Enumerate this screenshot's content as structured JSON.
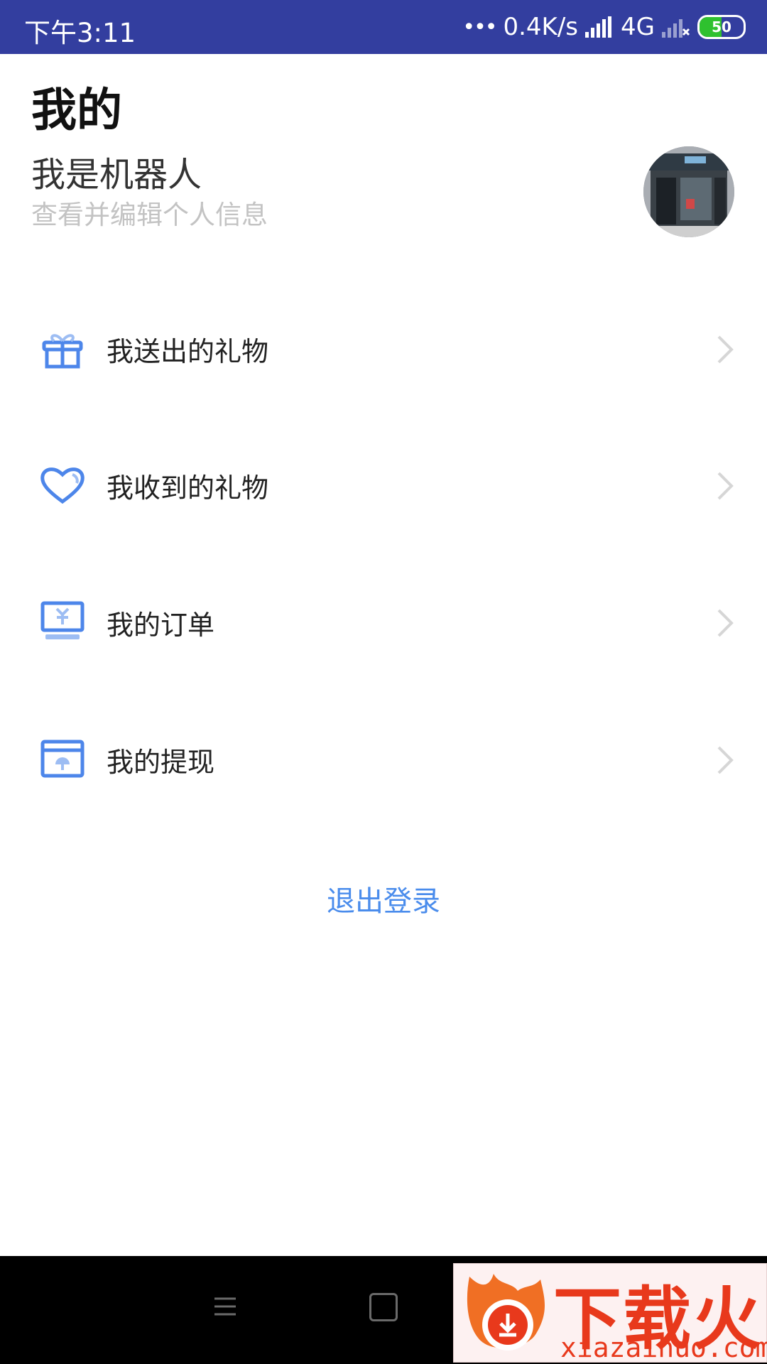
{
  "status_bar": {
    "time": "下午3:11",
    "network_speed": "0.4K/s",
    "network_type": "4G",
    "battery": "50",
    "battery_level_percent": 50
  },
  "header": {
    "title": "我的",
    "username": "我是机器人",
    "subtitle": "查看并编辑个人信息"
  },
  "menu": {
    "items": [
      {
        "label": "我送出的礼物",
        "icon": "gift-icon"
      },
      {
        "label": "我收到的礼物",
        "icon": "heart-icon"
      },
      {
        "label": "我的订单",
        "icon": "order-icon"
      },
      {
        "label": "我的提现",
        "icon": "withdraw-icon"
      }
    ]
  },
  "logout": {
    "label": "退出登录"
  },
  "watermark": {
    "title": "下载火",
    "url": "xiazaihuo.com"
  },
  "colors": {
    "status_bar": "#333e9f",
    "accent": "#4a8cec",
    "icon_blue": "#4d86ea",
    "subtitle_gray": "#c3c3c3"
  }
}
